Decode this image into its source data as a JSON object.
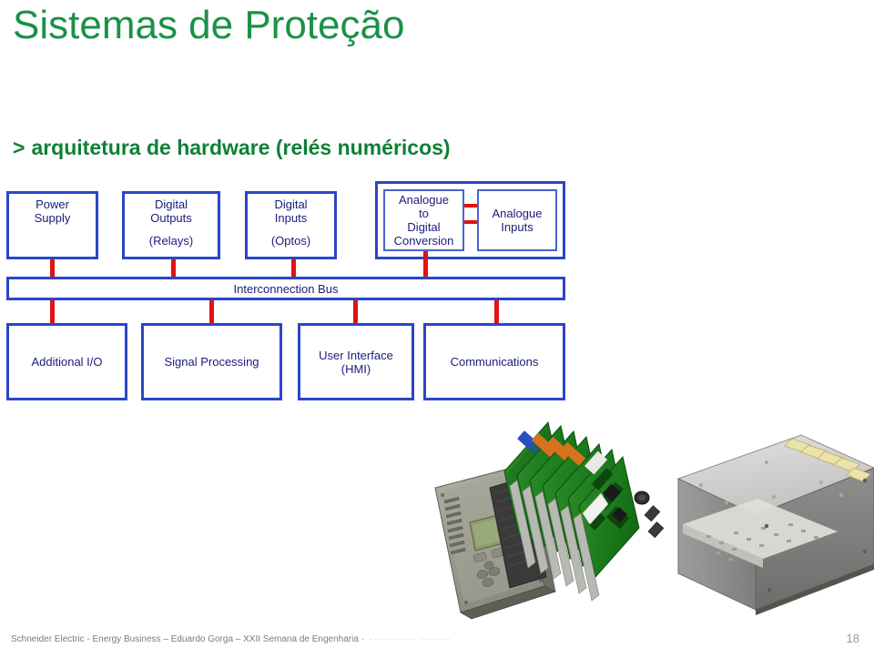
{
  "slide": {
    "title": "Sistemas de Proteção",
    "subtitle_bullet": ">",
    "subtitle": "arquitetura de hardware (relés numéricos)",
    "number": "18"
  },
  "footer": {
    "text": "Schneider Electric - Energy Business – Eduardo Gorga – XXII Semana de Engenharia ·",
    "faded_tail": "············  ········"
  },
  "colors": {
    "title_green": "#1a9245",
    "subtitle_green": "#0e8034",
    "box_border_blue": "#2a46c8",
    "box_text_blue": "#1b1b7a",
    "connector_red": "#e21212",
    "footer_gray": "#7b7b7b"
  },
  "diagram": {
    "type": "block-diagram",
    "top_row": [
      {
        "id": "power-supply",
        "line1": "Power",
        "line2": "Supply",
        "sub": ""
      },
      {
        "id": "digital-outputs",
        "line1": "Digital",
        "line2": "Outputs",
        "sub": "(Relays)"
      },
      {
        "id": "digital-inputs",
        "line1": "Digital",
        "line2": "Inputs",
        "sub": "(Optos)"
      }
    ],
    "analogue_group": {
      "adc": "Analogue to Digital Conversion",
      "adc_lines": [
        "Analogue",
        "to",
        "Digital",
        "Conversion"
      ],
      "analogue_inputs_lines": [
        "Analogue",
        "Inputs"
      ]
    },
    "bus": {
      "label": "Interconnection Bus"
    },
    "bottom_row": [
      {
        "id": "additional-io",
        "line1": "Additional I/O",
        "line2": ""
      },
      {
        "id": "signal-processing",
        "line1": "Signal Processing",
        "line2": ""
      },
      {
        "id": "user-interface",
        "line1": "User Interface",
        "line2": "(HMI)"
      },
      {
        "id": "communications",
        "line1": "Communications",
        "line2": ""
      }
    ]
  },
  "artwork": {
    "caption": "exploded view of a numerical relay: front panel (HMI), circuit board stack, metal case"
  }
}
